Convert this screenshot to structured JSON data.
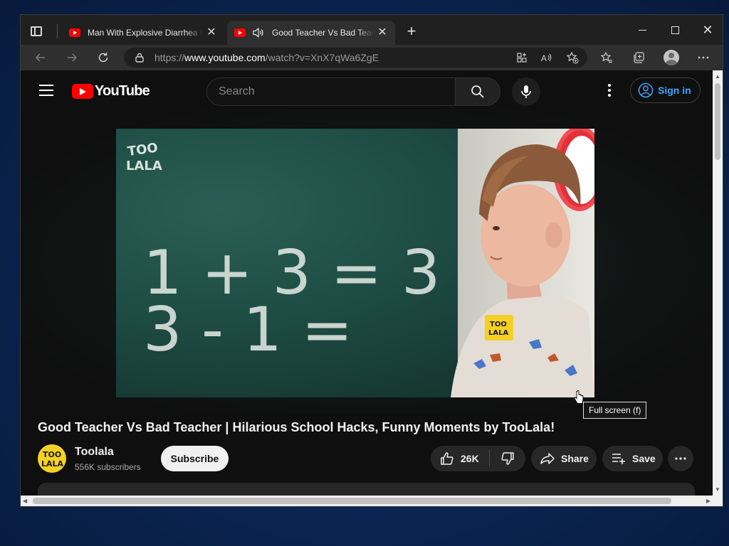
{
  "browser": {
    "tabs": [
      {
        "title": "Man With Explosive Diarrhea Meets Other Man With Explosive Diarrhea",
        "active": false,
        "favicon": "youtube-icon"
      },
      {
        "title": "Good Teacher Vs Bad Teacher | Hilarious School Hacks",
        "active": true,
        "favicon": "youtube-icon",
        "audio": "speaker-icon"
      }
    ],
    "new_tab_glyph": "+",
    "close_glyph": "✕",
    "window_controls": {
      "close_glyph": "✕"
    },
    "address": {
      "scheme": "https://",
      "host": "www.youtube.com",
      "path": "/watch?v=XnX7qWa6ZgE"
    },
    "toolbar_icons": [
      "back-icon",
      "forward-icon",
      "refresh-icon",
      "lock-icon",
      "app-available-icon",
      "read-aloud-icon",
      "add-favorite-icon",
      "favorites-icon",
      "collections-icon",
      "profile-icon",
      "settings-more-icon"
    ]
  },
  "youtube": {
    "logo_text": "YouTube",
    "search_placeholder": "Search",
    "sign_in_label": "Sign in",
    "video": {
      "title": "Good Teacher Vs Bad Teacher | Hilarious School Hacks, Funny Moments by TooLala!",
      "board_text_line1": "1 + 3 = 3",
      "board_text_line2": "3 - 1 =",
      "watermark": "TOO LALA",
      "tooltip": "Full screen (f)"
    },
    "channel": {
      "name": "Toolala",
      "subscribers": "556K subscribers",
      "subscribe_label": "Subscribe",
      "avatar_text": "TOO LALA"
    },
    "actions": {
      "like_count": "26K",
      "share_label": "Share",
      "save_label": "Save"
    }
  },
  "colors": {
    "accent_red": "#ff0000",
    "link_blue": "#3ea6ff",
    "page_bg": "#0f0f0f",
    "brand_yellow": "#f5d024"
  }
}
